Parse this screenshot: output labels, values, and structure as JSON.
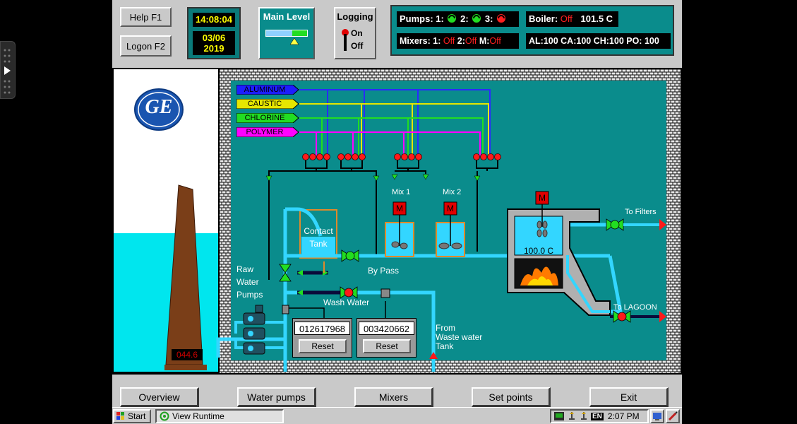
{
  "header": {
    "help_label": "Help  F1",
    "logon_label": "Logon F2",
    "time": "14:08:04",
    "date_line1": "03/06",
    "date_line2": "2019",
    "main_level_title": "Main Level",
    "logging_title": "Logging",
    "logging_on": "On",
    "logging_off": "Off"
  },
  "status": {
    "pumps_label": "Pumps: 1:",
    "pump2_label": "2:",
    "pump3_label": "3:",
    "boiler_label": "Boiler:",
    "boiler_state": "Off",
    "boiler_temp": "101.5 C",
    "mixers_label": "Mixers: 1:",
    "mixer1_state": "Off",
    "mixer2_label": "2:",
    "mixer2_state": "Off",
    "mixerm_label": "M:",
    "mixerm_state": "Off",
    "levels": "AL:100 CA:100  CH:100  PO: 100"
  },
  "process": {
    "chemicals": [
      {
        "label": "ALUMINUM",
        "color": "#1d1dff"
      },
      {
        "label": "CAUSTIC",
        "color": "#e6e600"
      },
      {
        "label": "CHLORINE",
        "color": "#22dd22"
      },
      {
        "label": "POLYMER",
        "color": "#ff00ff"
      }
    ],
    "mix1_label": "Mix 1",
    "mix2_label": "Mix 2",
    "motor_label": "M",
    "contact_tank_line1": "Contact",
    "contact_tank_line2": "Tank",
    "bypass_label": "By Pass",
    "raw_water_line1": "Raw",
    "raw_water_line2": "Water",
    "raw_water_line3": "Pumps",
    "wash_water_label": "Wash Water",
    "counter1": "012617968",
    "counter2": "003420662",
    "reset_label": "Reset",
    "from_waste_line1": "From",
    "from_waste_line2": "Waste water",
    "from_waste_line3": "Tank",
    "boiler_temp": "100.0 C",
    "to_filters": "To Filters",
    "to_lagoon": "To LAGOON",
    "tower_reading": "044.6",
    "logo_text": "GE"
  },
  "nav": {
    "overview": "Overview",
    "water_pumps": "Water pumps",
    "mixers": "Mixers",
    "set_points": "Set points",
    "exit": "Exit"
  },
  "taskbar": {
    "start": "Start",
    "task": "View Runtime",
    "lang": "EN",
    "clock": "2:07 PM"
  },
  "colors": {
    "teal": "#0a8c8c",
    "water": "#33d6ff",
    "panel_gray": "#c9c9c9",
    "pipe_dark": "#0a0a3a",
    "alarm_red": "#ff0000"
  }
}
